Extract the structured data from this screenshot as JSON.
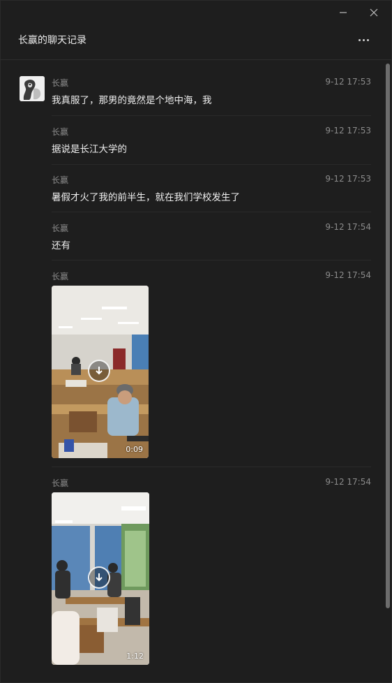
{
  "window": {
    "minimize_icon": "minimize-icon",
    "close_icon": "close-icon"
  },
  "header": {
    "title": "长赢的聊天记录",
    "more_icon": "more-icon"
  },
  "messages": [
    {
      "sender": "长赢",
      "time": "9-12 17:53",
      "text": "我真服了，那男的竟然是个地中海，我"
    },
    {
      "sender": "长赢",
      "time": "9-12 17:53",
      "text": "据说是长江大学的"
    },
    {
      "sender": "长赢",
      "time": "9-12 17:53",
      "text": "暑假才火了我的前半生，就在我们学校发生了"
    },
    {
      "sender": "长赢",
      "time": "9-12 17:54",
      "text": "还有"
    },
    {
      "sender": "长赢",
      "time": "9-12 17:54",
      "video_duration": "0:09"
    },
    {
      "sender": "长赢",
      "time": "9-12 17:54",
      "video_duration": "1:12"
    }
  ],
  "colors": {
    "background": "#1e1e1e",
    "secondary_text": "#8b8b8b",
    "primary_text": "#f0f0f0"
  }
}
